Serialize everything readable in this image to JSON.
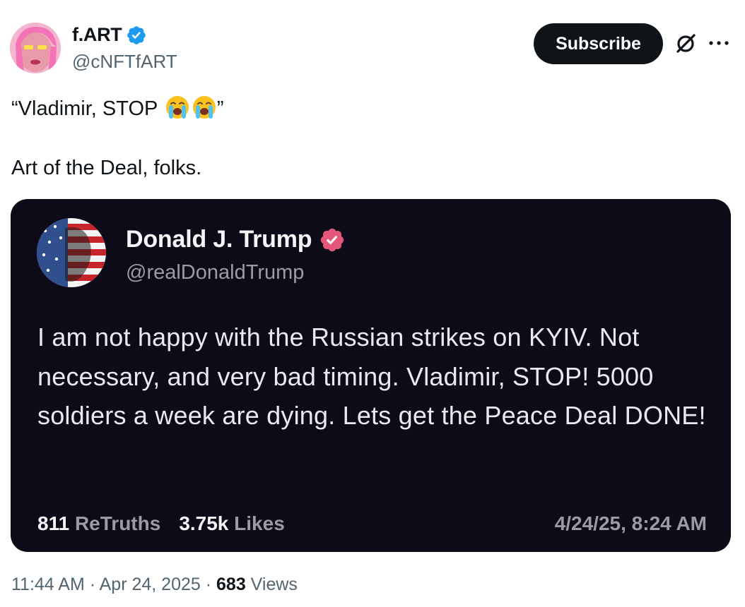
{
  "author": {
    "display_name": "f.ART",
    "handle": "@cNFTfART",
    "verified": true,
    "avatar_icon": "pink-character-avatar"
  },
  "header_actions": {
    "subscribe_label": "Subscribe",
    "grok_icon": "grok-slash-circle-icon",
    "more_icon": "more-horizontal-icon"
  },
  "tweet": {
    "line1_text": "“Vladimir, STOP ",
    "line1_emoji": [
      "loudly-crying-face",
      "loudly-crying-face"
    ],
    "line1_close": "”",
    "line2_text": "Art of the Deal, folks."
  },
  "embed": {
    "display_name": "Donald J. Trump",
    "handle": "@realDonaldTrump",
    "verified": true,
    "body": "I am not happy with the Russian strikes on KYIV. Not necessary, and very bad timing. Vladimir, STOP! 5000 soldiers a week are dying. Lets get the Peace Deal DONE!",
    "retruths_count": "811",
    "retruths_label": "ReTruths",
    "likes_count": "3.75k",
    "likes_label": "Likes",
    "timestamp": "4/24/25, 8:24 AM"
  },
  "meta": {
    "time": "11:44 AM",
    "separator": " · ",
    "date": "Apr 24, 2025",
    "views_count": "683",
    "views_label": " Views"
  },
  "colors": {
    "text_primary": "#0f1419",
    "text_secondary": "#536471",
    "verified_blue": "#1d9bf0",
    "embed_bg": "#0c0b17",
    "embed_verified_pink": "#e4567a"
  }
}
